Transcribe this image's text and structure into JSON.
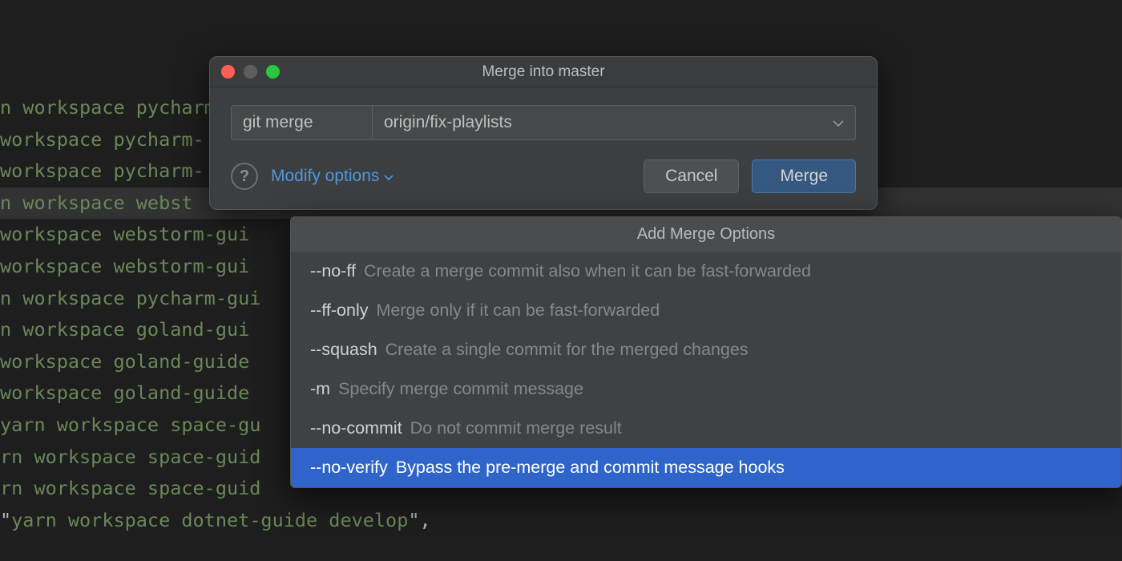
{
  "editor_lines": [
    "n workspace pycharm",
    "workspace pycharm-",
    "workspace pycharm-",
    "n workspace webst",
    "workspace webstorm-gui",
    "workspace webstorm-gui",
    "n workspace pycharm-gui",
    "n workspace goland-gui",
    "workspace goland-guide ",
    "workspace goland-guide ",
    "yarn workspace space-gu",
    "rn workspace space-guid",
    "rn workspace space-guid",
    "\"yarn workspace dotnet-guide develop\","
  ],
  "editor_highlight_index": 3,
  "dialog": {
    "title": "Merge into master",
    "command_prefix": "git merge",
    "branch": "origin/fix-playlists",
    "modify_label": "Modify options",
    "help_symbol": "?",
    "cancel_label": "Cancel",
    "merge_label": "Merge"
  },
  "popup": {
    "header": "Add Merge Options",
    "items": [
      {
        "flag": "--no-ff",
        "desc": "Create a merge commit also when it can be fast-forwarded"
      },
      {
        "flag": "--ff-only",
        "desc": "Merge only if it can be fast-forwarded"
      },
      {
        "flag": "--squash",
        "desc": "Create a single commit for the merged changes"
      },
      {
        "flag": "-m",
        "desc": "Specify merge commit message"
      },
      {
        "flag": "--no-commit",
        "desc": "Do not commit merge result"
      },
      {
        "flag": "--no-verify",
        "desc": "Bypass the pre-merge and commit message hooks"
      }
    ],
    "selected_index": 5
  }
}
